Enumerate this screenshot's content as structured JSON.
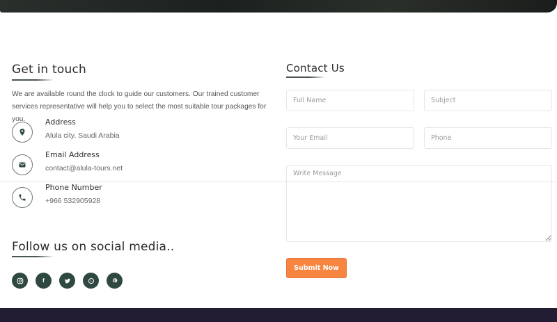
{
  "contact_info": {
    "heading": "Get in touch",
    "intro": "We are available round the clock to guide our customers. Our trained customer services representative will help you to select the most suitable tour packages for you.",
    "address": {
      "title": "Address",
      "value": "Alula city, Saudi Arabia",
      "icon": "map-pin-icon"
    },
    "email": {
      "title": "Email Address",
      "value": "contact@alula-tours.net",
      "icon": "envelope-icon"
    },
    "phone": {
      "title": "Phone Number",
      "value": "+966 532905928",
      "icon": "phone-icon"
    }
  },
  "social": {
    "heading": "Follow us on social media..",
    "links": [
      {
        "name": "instagram",
        "icon": "instagram-icon"
      },
      {
        "name": "facebook",
        "icon": "facebook-icon"
      },
      {
        "name": "twitter",
        "icon": "twitter-icon"
      },
      {
        "name": "whatsapp",
        "icon": "whatsapp-icon"
      },
      {
        "name": "pinterest",
        "icon": "pinterest-icon"
      }
    ],
    "icon_color": "#2f4841"
  },
  "contact_form": {
    "heading": "Contact Us",
    "full_name": {
      "placeholder": "Full Name",
      "value": ""
    },
    "subject": {
      "placeholder": "Subject",
      "value": ""
    },
    "email": {
      "placeholder": "Your Email",
      "value": ""
    },
    "phone": {
      "placeholder": "Phone",
      "value": ""
    },
    "message": {
      "placeholder": "Write Message",
      "value": ""
    },
    "submit_label": "Submit Now",
    "submit_color": "#f7853f"
  },
  "colors": {
    "footer_background": "#221d33",
    "heading_text": "#2b2b2b"
  }
}
